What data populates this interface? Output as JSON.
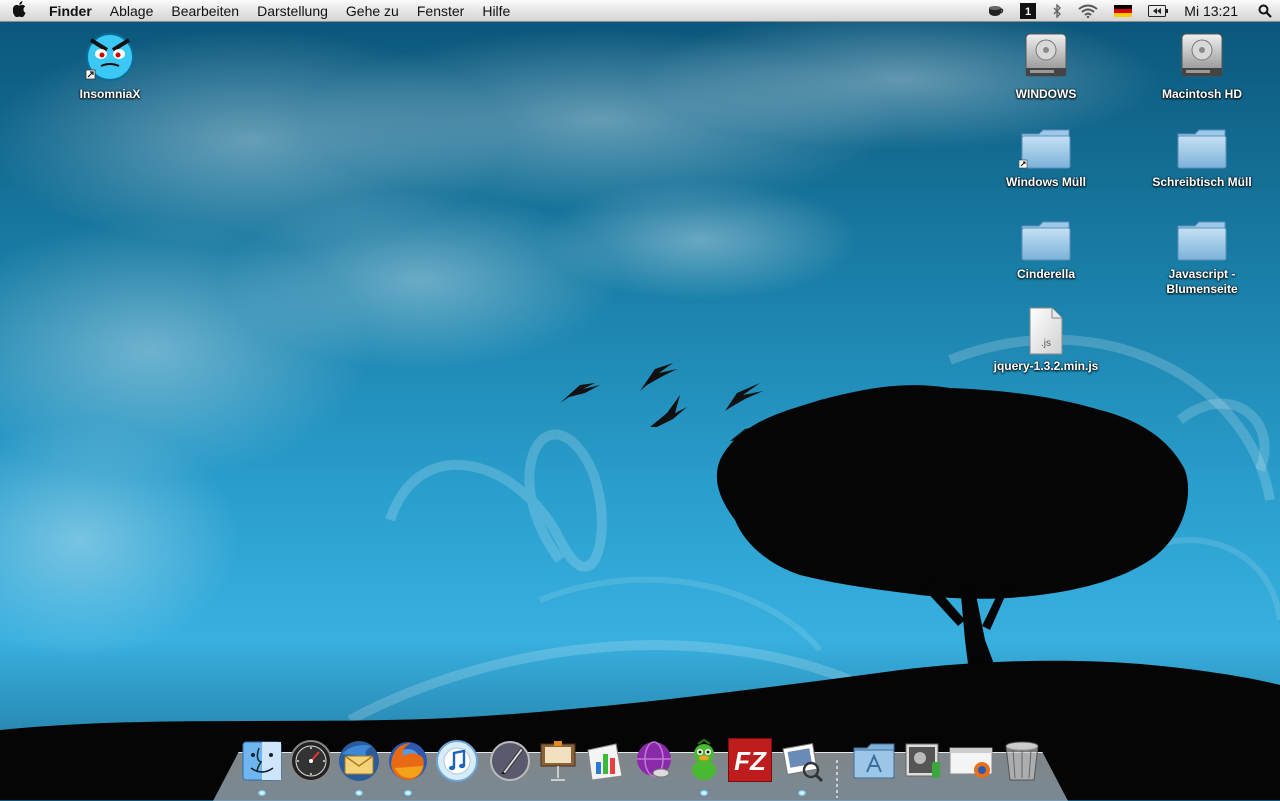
{
  "menubar": {
    "app_name": "Finder",
    "items": [
      "Ablage",
      "Bearbeiten",
      "Darstellung",
      "Gehe zu",
      "Fenster",
      "Hilfe"
    ],
    "clock": "Mi 13:21"
  },
  "desktop": {
    "icons": [
      {
        "label": "InsomniaX"
      },
      {
        "label": "WINDOWS"
      },
      {
        "label": "Macintosh HD"
      },
      {
        "label": "Windows Müll"
      },
      {
        "label": "Schreibtisch Müll"
      },
      {
        "label": "Cinderella"
      },
      {
        "label": "Javascript - Blumenseite"
      },
      {
        "label": "jquery-1.3.2.min.js"
      }
    ],
    "js_file_badge": ".js"
  },
  "dock": {
    "items": [
      "finder-icon",
      "dashboard-icon",
      "thunderbird-icon",
      "firefox-icon",
      "itunes-icon",
      "ical-icon",
      "keynote-icon",
      "numbers-icon",
      "adium-icon",
      "filezilla-icon",
      "preview-icon",
      "applications-folder-icon",
      "stack-icon",
      "downloads-stack-icon",
      "trash-icon"
    ],
    "filezilla_text": "FZ"
  },
  "colors": {
    "accent_sky": "#2a9fce",
    "folder_blue": "#8fc4e6",
    "filezilla_red": "#bf1d1d"
  }
}
